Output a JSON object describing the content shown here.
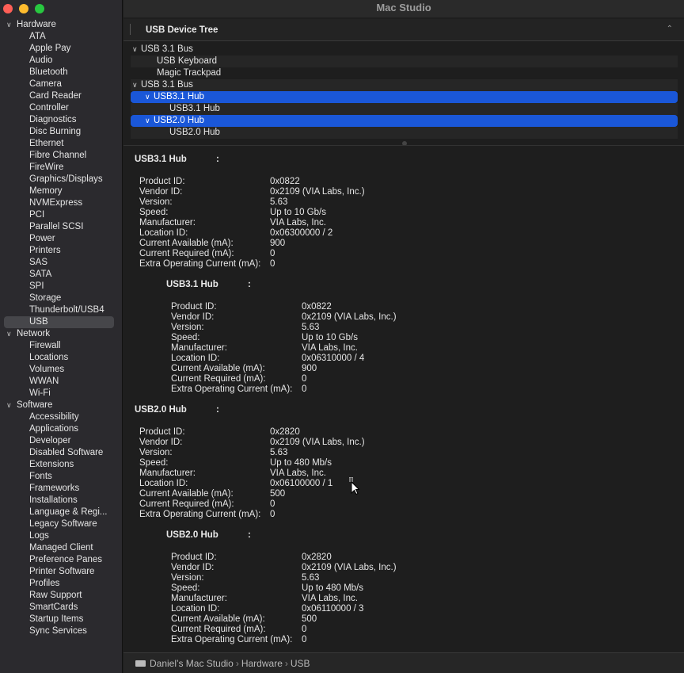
{
  "window": {
    "title": "Mac Studio"
  },
  "sidebar": {
    "sections": [
      {
        "label": "Hardware",
        "items": [
          "ATA",
          "Apple Pay",
          "Audio",
          "Bluetooth",
          "Camera",
          "Card Reader",
          "Controller",
          "Diagnostics",
          "Disc Burning",
          "Ethernet",
          "Fibre Channel",
          "FireWire",
          "Graphics/Displays",
          "Memory",
          "NVMExpress",
          "PCI",
          "Parallel SCSI",
          "Power",
          "Printers",
          "SAS",
          "SATA",
          "SPI",
          "Storage",
          "Thunderbolt/USB4",
          "USB"
        ]
      },
      {
        "label": "Network",
        "items": [
          "Firewall",
          "Locations",
          "Volumes",
          "WWAN",
          "Wi-Fi"
        ]
      },
      {
        "label": "Software",
        "items": [
          "Accessibility",
          "Applications",
          "Developer",
          "Disabled Software",
          "Extensions",
          "Fonts",
          "Frameworks",
          "Installations",
          "Language & Regi...",
          "Legacy Software",
          "Logs",
          "Managed Client",
          "Preference Panes",
          "Printer Software",
          "Profiles",
          "Raw Support",
          "SmartCards",
          "Startup Items",
          "Sync Services"
        ]
      }
    ],
    "selected": "USB"
  },
  "tree_header": {
    "title": "USB Device Tree"
  },
  "device_tree": [
    {
      "label": "USB 3.1 Bus",
      "level": 0,
      "expanded": true,
      "selected": false
    },
    {
      "label": "USB Keyboard",
      "level": 1,
      "expanded": false,
      "selected": false
    },
    {
      "label": "Magic Trackpad",
      "level": 1,
      "expanded": false,
      "selected": false
    },
    {
      "label": "USB 3.1 Bus",
      "level": 0,
      "expanded": true,
      "selected": false
    },
    {
      "label": "USB3.1 Hub",
      "level": 1,
      "expanded": true,
      "selected": true
    },
    {
      "label": "USB3.1 Hub",
      "level": 2,
      "expanded": false,
      "selected": false
    },
    {
      "label": "USB2.0 Hub",
      "level": 1,
      "expanded": true,
      "selected": true
    },
    {
      "label": "USB2.0 Hub",
      "level": 2,
      "expanded": false,
      "selected": false
    }
  ],
  "details": [
    {
      "title": "USB3.1 Hub",
      "colon": ":",
      "rows": [
        [
          "Product ID:",
          "0x0822"
        ],
        [
          "Vendor ID:",
          "0x2109  (VIA Labs, Inc.)"
        ],
        [
          "Version:",
          "5.63"
        ],
        [
          "Speed:",
          "Up to 10 Gb/s"
        ],
        [
          "Manufacturer:",
          "VIA Labs, Inc."
        ],
        [
          "Location ID:",
          "0x06300000 / 2"
        ],
        [
          "Current Available (mA):",
          "900"
        ],
        [
          "Current Required (mA):",
          "0"
        ],
        [
          "Extra Operating Current (mA):",
          "0"
        ]
      ]
    },
    {
      "title": "USB3.1 Hub",
      "colon": ":",
      "rows": [
        [
          "Product ID:",
          "0x0822"
        ],
        [
          "Vendor ID:",
          "0x2109  (VIA Labs, Inc.)"
        ],
        [
          "Version:",
          "5.63"
        ],
        [
          "Speed:",
          "Up to 10 Gb/s"
        ],
        [
          "Manufacturer:",
          "VIA Labs, Inc."
        ],
        [
          "Location ID:",
          "0x06310000 / 4"
        ],
        [
          "Current Available (mA):",
          "900"
        ],
        [
          "Current Required (mA):",
          "0"
        ],
        [
          "Extra Operating Current (mA):",
          "0"
        ]
      ]
    },
    {
      "title": "USB2.0 Hub",
      "colon": ":",
      "rows": [
        [
          "Product ID:",
          "0x2820"
        ],
        [
          "Vendor ID:",
          "0x2109  (VIA Labs, Inc.)"
        ],
        [
          "Version:",
          "5.63"
        ],
        [
          "Speed:",
          "Up to 480 Mb/s"
        ],
        [
          "Manufacturer:",
          "VIA Labs, Inc."
        ],
        [
          "Location ID:",
          "0x06100000 / 1"
        ],
        [
          "Current Available (mA):",
          "500"
        ],
        [
          "Current Required (mA):",
          "0"
        ],
        [
          "Extra Operating Current (mA):",
          "0"
        ]
      ]
    },
    {
      "title": "USB2.0 Hub",
      "colon": ":",
      "rows": [
        [
          "Product ID:",
          "0x2820"
        ],
        [
          "Vendor ID:",
          "0x2109  (VIA Labs, Inc.)"
        ],
        [
          "Version:",
          "5.63"
        ],
        [
          "Speed:",
          "Up to 480 Mb/s"
        ],
        [
          "Manufacturer:",
          "VIA Labs, Inc."
        ],
        [
          "Location ID:",
          "0x06110000 / 3"
        ],
        [
          "Current Available (mA):",
          "500"
        ],
        [
          "Current Required (mA):",
          "0"
        ],
        [
          "Extra Operating Current (mA):",
          "0"
        ]
      ]
    }
  ],
  "pathbar": {
    "items": [
      "Daniel’s Mac Studio",
      "Hardware",
      "USB"
    ],
    "separator": "›"
  },
  "colors": {
    "selection": "#1a57d8",
    "sidebar_bg": "#2b2a2e",
    "content_bg": "#1e1e1e"
  },
  "icons": [
    "chevron-down-icon",
    "chevron-up-icon",
    "computer-icon",
    "pointer-cursor-icon"
  ]
}
